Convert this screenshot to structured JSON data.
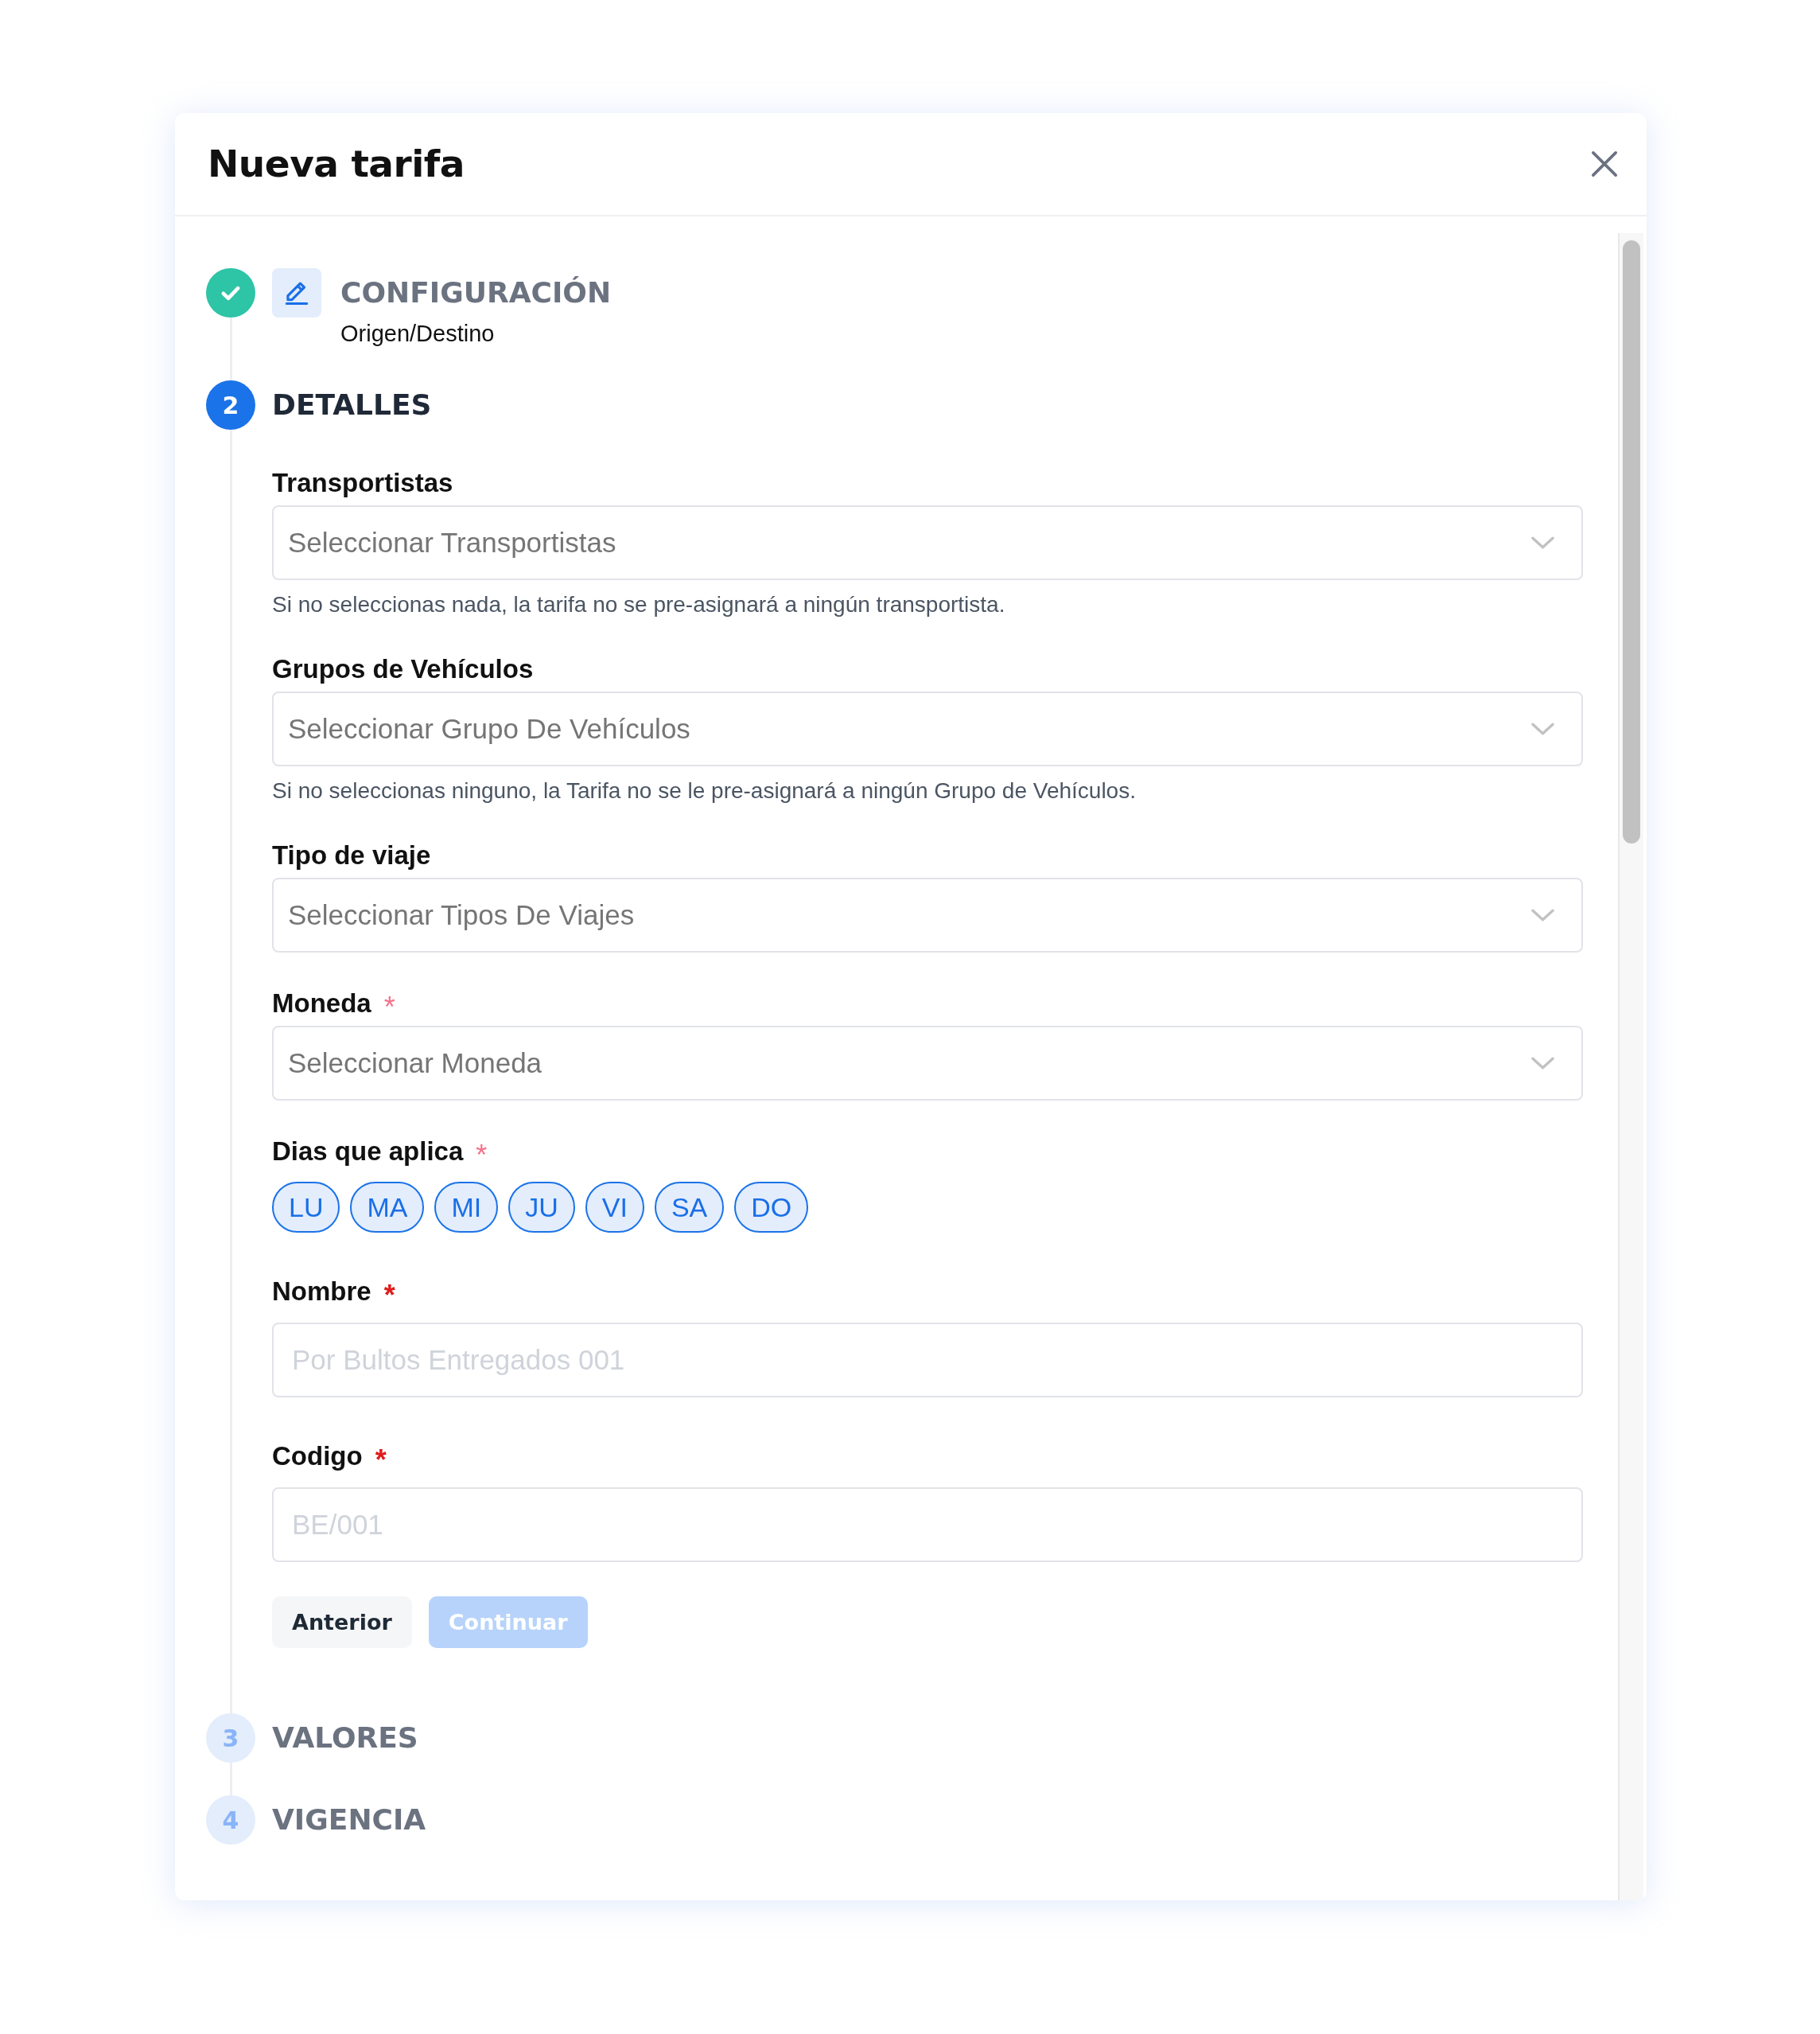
{
  "modal": {
    "title": "Nueva tarifa"
  },
  "steps": [
    {
      "completed": true,
      "selected": false,
      "title": "CONFIGURACIÓN",
      "subtitle": "Origen/Destino",
      "editable": true
    },
    {
      "completed": false,
      "selected": true,
      "number": "2",
      "title": "DETALLES",
      "form": {
        "fields": [
          {
            "kind": "select",
            "label": "Transportistas",
            "placeholder": "Seleccionar Transportistas",
            "helper": "Si no seleccionas nada, la tarifa no se pre-asignará a ningún transportista."
          },
          {
            "kind": "select",
            "label": "Grupos de Vehículos",
            "placeholder": "Seleccionar Grupo De Vehículos",
            "helper": "Si no seleccionas ninguno, la Tarifa no se le pre-asignará a ningún Grupo de Vehículos."
          },
          {
            "kind": "select",
            "label": "Tipo de viaje",
            "placeholder": "Seleccionar Tipos De Viajes"
          },
          {
            "kind": "select",
            "label": "Moneda",
            "required_mark": "*",
            "placeholder": "Seleccionar Moneda"
          },
          {
            "kind": "days",
            "label": "Dias que aplica",
            "required_mark": "*",
            "days": [
              {
                "label": "LU",
                "selected": true
              },
              {
                "label": "MA",
                "selected": true
              },
              {
                "label": "MI",
                "selected": true
              },
              {
                "label": "JU",
                "selected": true
              },
              {
                "label": "VI",
                "selected": true
              },
              {
                "label": "SA",
                "selected": true
              },
              {
                "label": "DO",
                "selected": true
              }
            ]
          },
          {
            "kind": "text",
            "label": "Nombre",
            "required_mark": "*",
            "placeholder": "Por Bultos Entregados 001"
          },
          {
            "kind": "text",
            "label": "Codigo",
            "required_mark": "*",
            "placeholder": "BE/001"
          }
        ],
        "buttons": [
          {
            "kind": "secondary",
            "label": "Anterior",
            "disabled": false
          },
          {
            "kind": "primary",
            "label": "Continuar",
            "disabled": true
          }
        ]
      }
    },
    {
      "completed": false,
      "selected": false,
      "number": "3",
      "title": "VALORES"
    },
    {
      "completed": false,
      "selected": false,
      "number": "4",
      "title": "VIGENCIA"
    }
  ]
}
